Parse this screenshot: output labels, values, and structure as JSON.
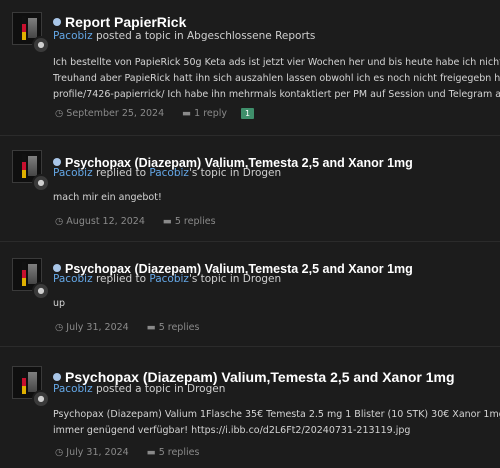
{
  "entries": [
    {
      "title": "Report PapierRick",
      "author": "Pacobiz",
      "action": "posted a topic in",
      "target_user": "",
      "forum": "Abgeschlossene Reports",
      "body_lines": [
        "Ich bestellte von PapieRick 50g Keta ads ist jetzt vier Wochen her und bis heute habe ich nichts bekommen! Es lief alles über",
        "Treuhand aber PapieRick hatt ihn sich auszahlen lassen obwohl ich es noch nicht freigegebn hatte! https://blacknet.is/index.php?/",
        "profile/7426-papierrick/ Ich habe ihn mehrmals kontaktiert per PM auf Session und Telegram aber keine Rückmeldung! Ich"
      ],
      "date": "September 25, 2024",
      "replies": "1 reply",
      "tag": "1"
    },
    {
      "title": "Psychopax (Diazepam) Valium,Temesta 2,5 and Xanor 1mg",
      "author": "Pacobiz",
      "action": "replied to",
      "target_user": "Pacobiz",
      "target_suffix": "'s topic in",
      "forum": "Drogen",
      "body_lines": [
        "mach mir ein angebot!"
      ],
      "date": "August 12, 2024",
      "replies": "5 replies"
    },
    {
      "title": "Psychopax (Diazepam) Valium,Temesta 2,5 and Xanor 1mg",
      "author": "Pacobiz",
      "action": "replied to",
      "target_user": "Pacobiz",
      "target_suffix": "'s topic in",
      "forum": "Drogen",
      "body_lines": [
        "up"
      ],
      "date": "July 31, 2024",
      "replies": "5 replies"
    },
    {
      "title": "Psychopax (Diazepam) Valium,Temesta 2,5 and Xanor 1mg",
      "author": "Pacobiz",
      "action": "posted a topic in",
      "target_user": "",
      "forum": "Drogen",
      "body_lines": [
        "Psychopax (Diazepam) Valium 1Flasche 35€ Temesta 2.5 mg 1 Blister (10 STK) 30€ Xanor 1mg 1 Blister (10STK.) 30€ Es ist",
        "immer genügend verfügbar! https://i.ibb.co/d2L6Ft2/20240731-213119.jpg"
      ],
      "date": "July 31, 2024",
      "replies": "5 replies"
    }
  ],
  "icons": {
    "unread": "unread-dot-icon",
    "badge": "comment-icon",
    "clock": "clock-icon",
    "comments": "comments-icon"
  }
}
